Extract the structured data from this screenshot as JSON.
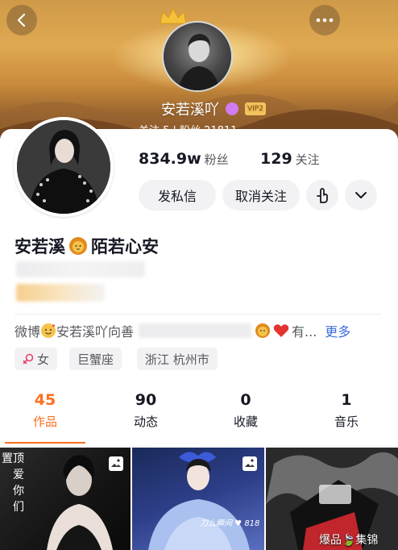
{
  "header": {
    "display_name": "安若溪吖",
    "vip_label": "VIP2",
    "top_stats_text": "关注 5   |   粉丝 21811"
  },
  "profile": {
    "followers_count": "834.9w",
    "followers_label": "粉丝",
    "following_count": "129",
    "following_label": "关注",
    "nickname_text": "安若溪",
    "nickname_suffix": "陌若心安",
    "message_button": "发私信",
    "unfollow_button": "取消关注"
  },
  "bio": {
    "prefix": "微博",
    "text": "安若溪吖向善",
    "ellipsis": "有...",
    "more_link": "更多"
  },
  "tags": {
    "gender": "女",
    "zodiac": "巨蟹座",
    "location": "浙江 杭州市"
  },
  "tabs": [
    {
      "count": "45",
      "label": "作品",
      "active": true
    },
    {
      "count": "90",
      "label": "动态"
    },
    {
      "count": "0",
      "label": "收藏"
    },
    {
      "count": "1",
      "label": "音乐"
    }
  ],
  "grid": {
    "pinned_label_1": "置顶",
    "pinned_label_2": "爱",
    "pinned_label_3": "你",
    "pinned_label_4": "们",
    "caption_2": "刀么瞬间 ♥ 818",
    "caption_3": "爆品🍃集锦"
  },
  "colors": {
    "accent": "#fe6f1f",
    "link": "#3b6fe0",
    "button_bg": "#f2f2f4"
  },
  "icons": [
    "back-icon",
    "more-icon",
    "crown-icon",
    "pin-icon",
    "chevron-down-icon",
    "gender-female-icon",
    "album-icon"
  ]
}
